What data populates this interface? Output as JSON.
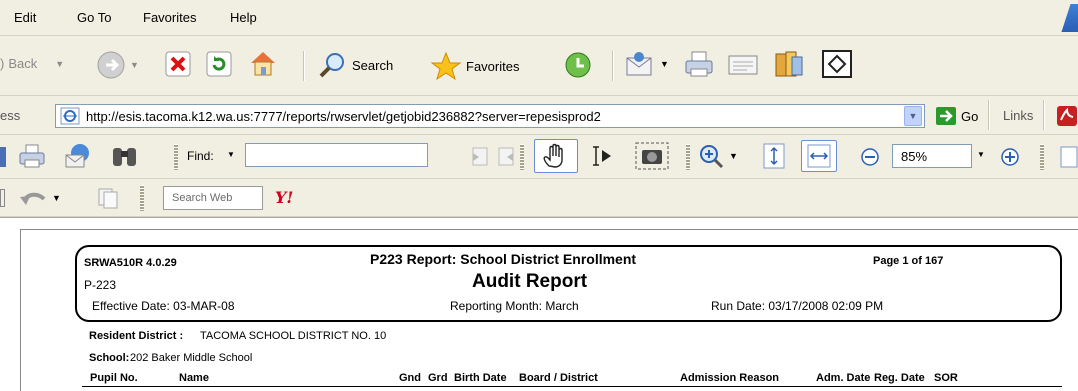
{
  "menu": {
    "items": [
      "Edit",
      "Go To",
      "Favorites",
      "Help"
    ]
  },
  "toolbar": {
    "back_label": "Back",
    "search_label": "Search",
    "favorites_label": "Favorites"
  },
  "address": {
    "label": "ess",
    "url": "http://esis.tacoma.k12.wa.us:7777/reports/rwservlet/getjobid236882?server=repesisprod2",
    "go_label": "Go",
    "links_label": "Links"
  },
  "pdf_toolbar": {
    "find_label": "Find:",
    "find_value": "",
    "zoom_value": "85%"
  },
  "search_toolbar": {
    "placeholder": "Search Web",
    "yahoo_label": "Y!"
  },
  "report": {
    "report_id": "SRWA510R 4.0.29",
    "report_title": "P223 Report: School District Enrollment",
    "page_info": "Page 1 of 167",
    "form_code": "P-223",
    "subtitle": "Audit Report",
    "effective_date": "Effective Date:  03-MAR-08",
    "reporting_month": "Reporting Month:  March",
    "run_date": "Run Date:  03/17/2008 02:09 PM",
    "resident_district_label": "Resident District :",
    "resident_district_value": "TACOMA SCHOOL DISTRICT NO. 10",
    "school_label": "School:",
    "school_value": "202  Baker Middle School",
    "columns": [
      "Pupil No.",
      "Name",
      "Gnd",
      "Grd",
      "Birth Date",
      "Board / District",
      "Admission Reason",
      "Adm. Date",
      "Reg. Date",
      "SOR"
    ]
  },
  "colors": {
    "accent_blue": "#2a5fb4",
    "go_green": "#2a9a2a",
    "toolbar_bg": "#f1efe2"
  }
}
